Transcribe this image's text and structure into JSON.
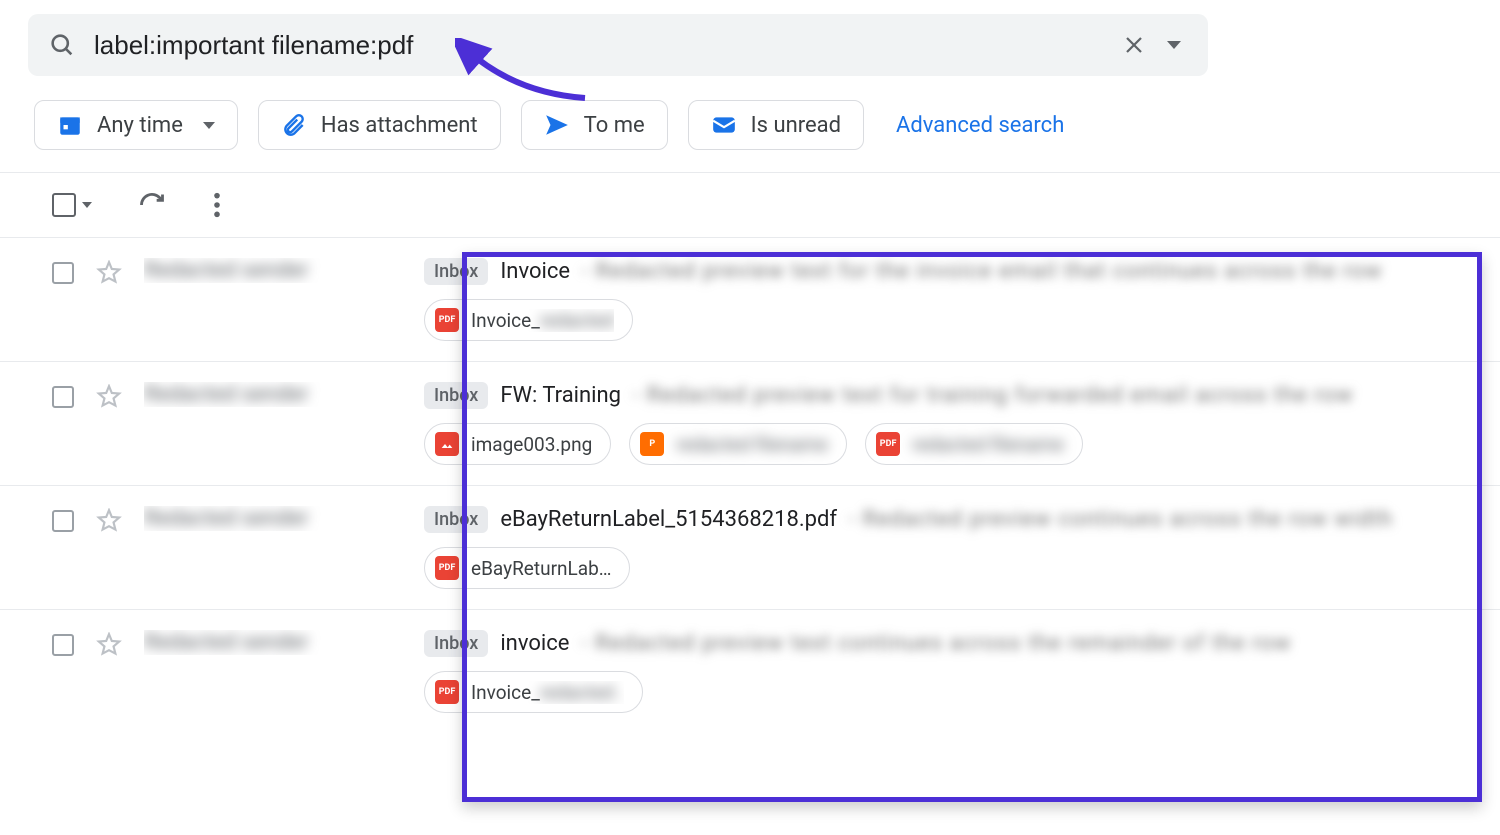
{
  "colors": {
    "accent": "#1a73e8",
    "annotation": "#4c2fd6"
  },
  "search": {
    "query": "label:important filename:pdf"
  },
  "filters": {
    "any_time": "Any time",
    "has_attachment": "Has attachment",
    "to_me": "To me",
    "is_unread": "Is unread",
    "advanced": "Advanced search"
  },
  "labels": {
    "inbox": "Inbox"
  },
  "emails": [
    {
      "sender": "Redacted sender",
      "subject": "Invoice",
      "snippet": "- Redacted preview text for the invoice email that continues across the row",
      "attachments": [
        {
          "type": "pdf",
          "name": "Invoice_",
          "rest": "redacted"
        }
      ]
    },
    {
      "sender": "Redacted sender",
      "subject": "FW: Training",
      "snippet": "- Redacted preview text for training forwarded email across the row",
      "attachments": [
        {
          "type": "img",
          "name": "image003.png"
        },
        {
          "type": "ppt",
          "name": "P",
          "rest": "redacted filename"
        },
        {
          "type": "pdf",
          "name": "",
          "rest": "redacted filename"
        }
      ]
    },
    {
      "sender": "Redacted sender",
      "subject": "eBayReturnLabel_5154368218.pdf",
      "snippet": "- Redacted preview continues across the row width",
      "attachments": [
        {
          "type": "pdf",
          "name": "eBayReturnLab…"
        }
      ]
    },
    {
      "sender": "Redacted sender",
      "subject": "invoice",
      "snippet": "- Redacted preview text continues across the remainder of the row",
      "attachments": [
        {
          "type": "pdf",
          "name": "Invoice_",
          "rest": "redacted ."
        }
      ]
    }
  ]
}
